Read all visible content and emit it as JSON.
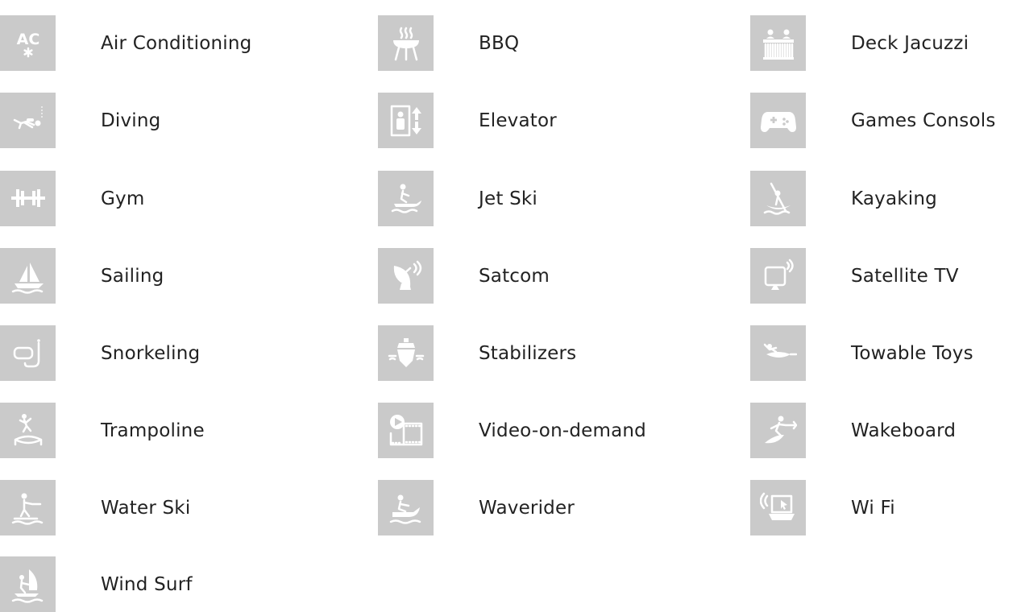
{
  "amenities": [
    {
      "label": "Air Conditioning",
      "icon": "air-conditioning-icon",
      "icon_text": "AC"
    },
    {
      "label": "BBQ",
      "icon": "bbq-icon"
    },
    {
      "label": "Deck Jacuzzi",
      "icon": "deck-jacuzzi-icon"
    },
    {
      "label": "Diving",
      "icon": "diving-icon"
    },
    {
      "label": "Elevator",
      "icon": "elevator-icon"
    },
    {
      "label": "Games Consols",
      "icon": "games-console-icon"
    },
    {
      "label": "Gym",
      "icon": "gym-icon"
    },
    {
      "label": "Jet Ski",
      "icon": "jet-ski-icon"
    },
    {
      "label": "Kayaking",
      "icon": "kayaking-icon"
    },
    {
      "label": "Sailing",
      "icon": "sailing-icon"
    },
    {
      "label": "Satcom",
      "icon": "satcom-icon"
    },
    {
      "label": "Satellite TV",
      "icon": "satellite-tv-icon"
    },
    {
      "label": "Snorkeling",
      "icon": "snorkeling-icon"
    },
    {
      "label": "Stabilizers",
      "icon": "stabilizers-icon"
    },
    {
      "label": "Towable Toys",
      "icon": "towable-toys-icon"
    },
    {
      "label": "Trampoline",
      "icon": "trampoline-icon"
    },
    {
      "label": "Video-on-demand",
      "icon": "video-on-demand-icon"
    },
    {
      "label": "Wakeboard",
      "icon": "wakeboard-icon"
    },
    {
      "label": "Water Ski",
      "icon": "water-ski-icon"
    },
    {
      "label": "Waverider",
      "icon": "waverider-icon"
    },
    {
      "label": "Wi Fi",
      "icon": "wifi-icon"
    },
    {
      "label": "Wind Surf",
      "icon": "wind-surf-icon"
    }
  ],
  "colors": {
    "tile_background": "#cacaca",
    "icon": "#ffffff",
    "text": "#222222"
  }
}
